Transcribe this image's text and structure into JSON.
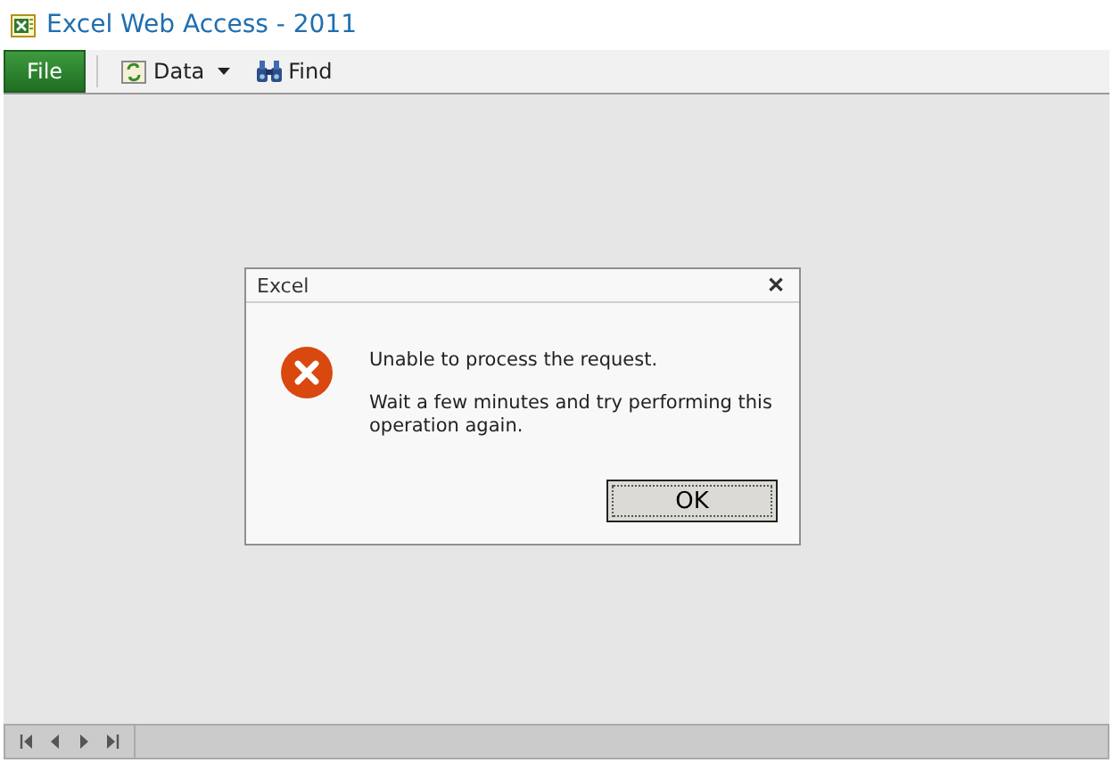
{
  "window": {
    "title": "Excel Web Access - 2011"
  },
  "toolbar": {
    "file": "File",
    "items": [
      {
        "label": "Data",
        "kind": "data",
        "dropdown": true
      },
      {
        "label": "Find",
        "kind": "find",
        "dropdown": false
      }
    ]
  },
  "dialog": {
    "title": "Excel",
    "close": "✕",
    "messages": [
      "Unable to process the request.",
      "Wait a few minutes and try performing this operation again."
    ],
    "button": "OK"
  },
  "sheet_nav": [
    {
      "kind": "first"
    },
    {
      "kind": "prev"
    },
    {
      "kind": "next"
    },
    {
      "kind": "last"
    }
  ]
}
